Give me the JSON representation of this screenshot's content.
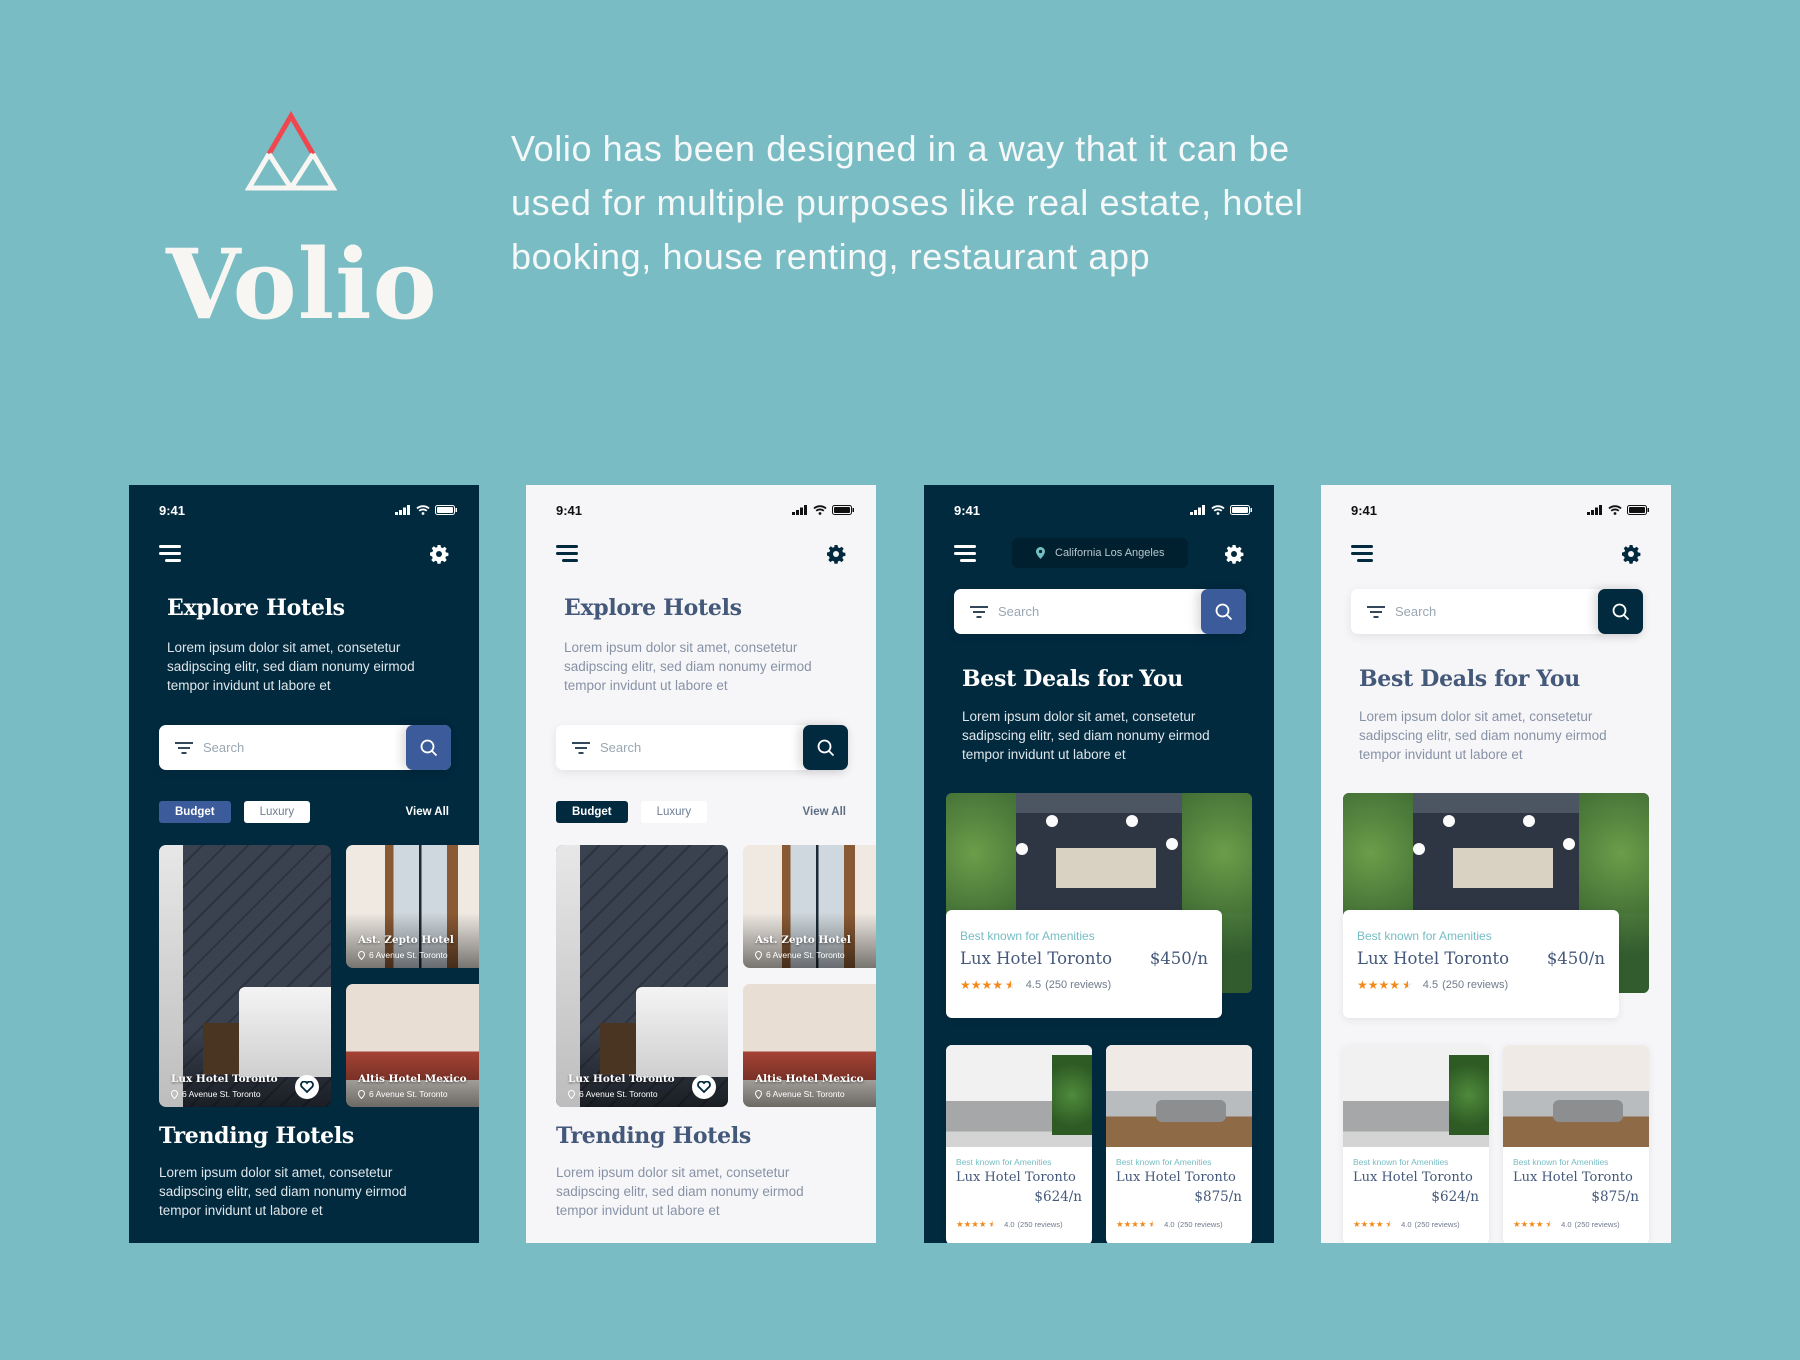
{
  "hero": {
    "brand": "Volio",
    "tagline": "Volio has been designed in a way that it can be used for multiple purposes like real estate, hotel booking, house renting, restaurant app",
    "colors": {
      "background": "#79bcc4",
      "logo_accent": "#f0474f",
      "logo_base": "#f7f6f2"
    }
  },
  "common": {
    "time": "9:41",
    "search_placeholder": "Search",
    "lorem": "Lorem ipsum dolor sit amet, consetetur sadipscing elitr, sed diam nonumy eirmod tempor invidunt ut labore et",
    "colors": {
      "navy": "#022a3f",
      "blue": "#3c5b9a",
      "teal_text": "#75bdc4",
      "star": "#f28a1b",
      "light_bg": "#f6f6f8"
    }
  },
  "explore": {
    "title": "Explore Hotels",
    "chips": [
      "Budget",
      "Luxury"
    ],
    "view_all": "View All",
    "hotels": [
      {
        "name": "Lux Hotel Toronto",
        "address": "6 Avenue St. Toronto",
        "favorite": true
      },
      {
        "name": "Ast. Zepto Hotel",
        "address": "6 Avenue St. Toronto"
      },
      {
        "name": "Altis Hotel Mexico",
        "address": "6 Avenue St. Toronto"
      }
    ],
    "trending_title": "Trending Hotels"
  },
  "deals": {
    "location": "California Los Angeles",
    "title": "Best Deals for You",
    "featured": {
      "tag": "Best known for Amenities",
      "name": "Lux Hotel Toronto",
      "price": "$450/n",
      "rating": "4.5",
      "reviews": "(250 reviews)",
      "stars": 4.5
    },
    "cards": [
      {
        "tag": "Best known for Amenities",
        "name": "Lux Hotel Toronto",
        "price": "$624/n",
        "rating": "4.0",
        "reviews": "(250 reviews)",
        "stars": 4.5
      },
      {
        "tag": "Best known for Amenities",
        "name": "Lux Hotel Toronto",
        "price": "$875/n",
        "rating": "4.0",
        "reviews": "(250 reviews)",
        "stars": 4.5
      }
    ]
  },
  "icons": {
    "menu": "menu-icon",
    "settings": "gear-icon",
    "filter": "filter-icon",
    "search": "search-icon",
    "location": "location-pin-icon",
    "heart": "heart-icon",
    "signal": "signal-icon",
    "wifi": "wifi-icon",
    "battery": "battery-icon",
    "star_full": "★",
    "star_half": "⯪"
  }
}
